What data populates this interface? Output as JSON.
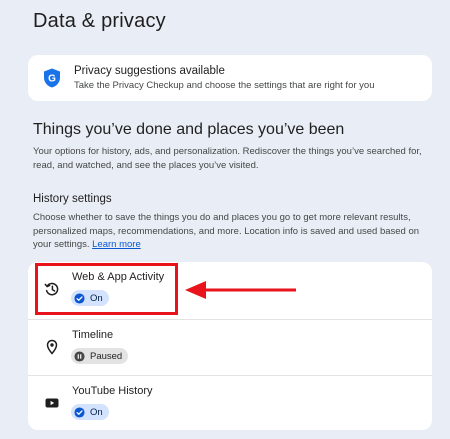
{
  "page": {
    "title": "Data & privacy"
  },
  "suggestion": {
    "title": "Privacy suggestions available",
    "subtitle": "Take the Privacy Checkup and choose the settings that are right for you",
    "icon": "google-shield-icon"
  },
  "section": {
    "title": "Things you’ve done and places you’ve been",
    "description": "Your options for history, ads, and personalization. Rediscover the things you’ve searched for, read, and watched, and see the places you’ve visited."
  },
  "history": {
    "title": "History settings",
    "description": "Choose whether to save the things you do and places you go to get more relevant results, personalized maps, recommendations, and more. Location info is saved and used based on your settings. ",
    "learn_more": "Learn more",
    "items": [
      {
        "label": "Web & App Activity",
        "status": "On",
        "icon": "history-icon"
      },
      {
        "label": "Timeline",
        "status": "Paused",
        "icon": "location-pin-icon"
      },
      {
        "label": "YouTube History",
        "status": "On",
        "icon": "youtube-icon"
      }
    ]
  },
  "colors": {
    "background": "#e9eef6",
    "accent": "#0b57d0",
    "highlight": "#e8131b",
    "chip_on": "#d3e3fd",
    "chip_paused": "#e3e3e3"
  }
}
